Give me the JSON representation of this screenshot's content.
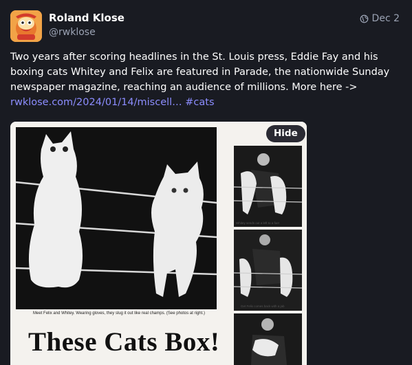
{
  "post": {
    "display_name": "Roland Klose",
    "acct": "@rwklose",
    "visibility_icon": "globe-icon",
    "date": "Dec 2",
    "text": "Two years after scoring headlines in the St. Louis press, Eddie Fay and his boxing cats Whitey and Felix are featured in Parade, the nationwide Sunday newspaper magazine, reaching an audience of millions. More here ->",
    "link": "rwklose.com/2024/01/14/miscell…",
    "hashtag": "#cats"
  },
  "media": {
    "hide_label": "Hide",
    "caption": "Meet Felix and Whitey. Wearing gloves, they slug it out like real champs. (See photos at right.)",
    "headline": "These Cats Box!",
    "side_caption_1": "Whitey sends out a left to a foe!",
    "side_caption_2": "Get Felix comes back with a jab"
  },
  "colors": {
    "background": "#191b22",
    "link": "#8c8dff",
    "muted": "#9ba3b4"
  }
}
